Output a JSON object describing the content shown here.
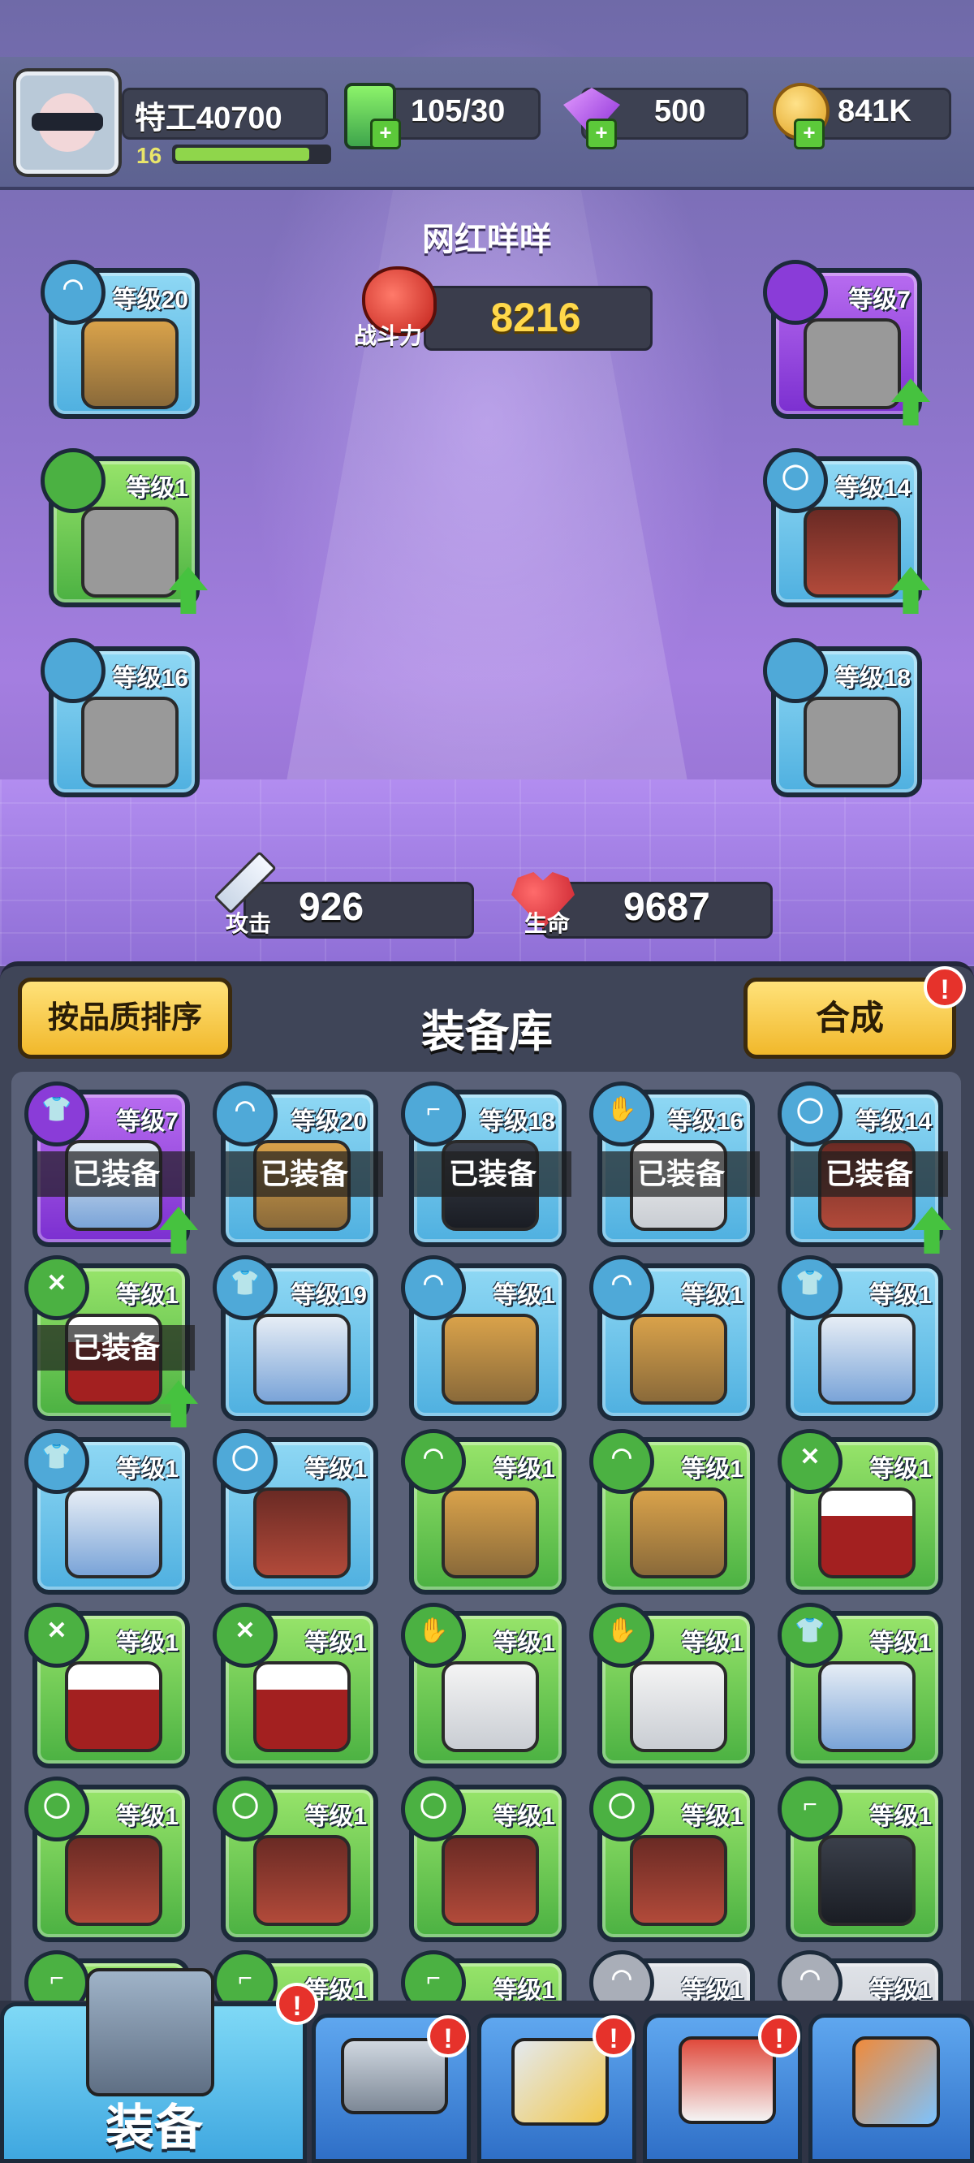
{
  "header": {
    "player_name": "特工40700",
    "player_level": "16",
    "xp_fraction": 0.88,
    "energy": "105/30",
    "gems": "500",
    "coins": "841K",
    "plus_symbol": "+"
  },
  "hero": {
    "name": "网红咩咩",
    "power_label": "战斗力",
    "power": "8216",
    "attack_label": "攻击",
    "attack": "926",
    "hp_label": "生命",
    "hp": "9687"
  },
  "equipped": [
    {
      "slot": "hat",
      "icon": "hat-icon",
      "level": "等级20",
      "quality": "blue",
      "upgrade": false
    },
    {
      "slot": "neck",
      "icon": "tie-icon",
      "level": "等级1",
      "quality": "green",
      "upgrade": true
    },
    {
      "slot": "gloves",
      "icon": "glove-icon",
      "level": "等级16",
      "quality": "blue",
      "upgrade": false
    },
    {
      "slot": "armor",
      "icon": "shirt-icon",
      "level": "等级7",
      "quality": "purple",
      "upgrade": true
    },
    {
      "slot": "belt",
      "icon": "belt-icon",
      "level": "等级14",
      "quality": "blue",
      "upgrade": true
    },
    {
      "slot": "boots",
      "icon": "boot-icon",
      "level": "等级18",
      "quality": "blue",
      "upgrade": false
    }
  ],
  "inventory": {
    "title": "装备库",
    "sort_button": "按品质排序",
    "merge_button": "合成",
    "alert_symbol": "!",
    "equipped_tag": "已装备",
    "items": [
      {
        "type": "shirt",
        "level": "等级7",
        "quality": "purple",
        "equipped": true,
        "upgrade": true
      },
      {
        "type": "hat",
        "level": "等级20",
        "quality": "blue",
        "equipped": true,
        "upgrade": false
      },
      {
        "type": "boot",
        "level": "等级18",
        "quality": "blue",
        "equipped": true,
        "upgrade": false
      },
      {
        "type": "glove",
        "level": "等级16",
        "quality": "blue",
        "equipped": true,
        "upgrade": false
      },
      {
        "type": "belt",
        "level": "等级14",
        "quality": "blue",
        "equipped": true,
        "upgrade": true
      },
      {
        "type": "tie",
        "level": "等级1",
        "quality": "green",
        "equipped": true,
        "upgrade": true
      },
      {
        "type": "shirt",
        "level": "等级19",
        "quality": "blue",
        "equipped": false,
        "upgrade": false
      },
      {
        "type": "hat",
        "level": "等级1",
        "quality": "blue",
        "equipped": false,
        "upgrade": false
      },
      {
        "type": "hat",
        "level": "等级1",
        "quality": "blue",
        "equipped": false,
        "upgrade": false
      },
      {
        "type": "shirt",
        "level": "等级1",
        "quality": "blue",
        "equipped": false,
        "upgrade": false
      },
      {
        "type": "shirt",
        "level": "等级1",
        "quality": "blue",
        "equipped": false,
        "upgrade": false
      },
      {
        "type": "belt",
        "level": "等级1",
        "quality": "blue",
        "equipped": false,
        "upgrade": false
      },
      {
        "type": "hat",
        "level": "等级1",
        "quality": "green",
        "equipped": false,
        "upgrade": false
      },
      {
        "type": "hat",
        "level": "等级1",
        "quality": "green",
        "equipped": false,
        "upgrade": false
      },
      {
        "type": "tie",
        "level": "等级1",
        "quality": "green",
        "equipped": false,
        "upgrade": false
      },
      {
        "type": "tie",
        "level": "等级1",
        "quality": "green",
        "equipped": false,
        "upgrade": false
      },
      {
        "type": "tie",
        "level": "等级1",
        "quality": "green",
        "equipped": false,
        "upgrade": false
      },
      {
        "type": "glove",
        "level": "等级1",
        "quality": "green",
        "equipped": false,
        "upgrade": false
      },
      {
        "type": "glove",
        "level": "等级1",
        "quality": "green",
        "equipped": false,
        "upgrade": false
      },
      {
        "type": "shirt",
        "level": "等级1",
        "quality": "green",
        "equipped": false,
        "upgrade": false
      },
      {
        "type": "belt",
        "level": "等级1",
        "quality": "green",
        "equipped": false,
        "upgrade": false
      },
      {
        "type": "belt",
        "level": "等级1",
        "quality": "green",
        "equipped": false,
        "upgrade": false
      },
      {
        "type": "belt",
        "level": "等级1",
        "quality": "green",
        "equipped": false,
        "upgrade": false
      },
      {
        "type": "belt",
        "level": "等级1",
        "quality": "green",
        "equipped": false,
        "upgrade": false
      },
      {
        "type": "boot",
        "level": "等级1",
        "quality": "green",
        "equipped": false,
        "upgrade": false
      },
      {
        "type": "boot",
        "level": "",
        "quality": "green",
        "equipped": false,
        "upgrade": false
      },
      {
        "type": "boot",
        "level": "等级1",
        "quality": "green",
        "equipped": false,
        "upgrade": false
      },
      {
        "type": "boot",
        "level": "等级1",
        "quality": "green",
        "equipped": false,
        "upgrade": false
      },
      {
        "type": "hat",
        "level": "等级1",
        "quality": "gray",
        "equipped": false,
        "upgrade": false
      },
      {
        "type": "hat",
        "level": "等级1",
        "quality": "gray",
        "equipped": false,
        "upgrade": false
      }
    ]
  },
  "nav": {
    "equip_label": "装备",
    "tabs": [
      "equipment-tab-icon",
      "pistol-icon",
      "crossed-swords-icon",
      "shop-icon",
      "dna-icon"
    ]
  },
  "colors": {
    "blue": "#4fb0e0",
    "green": "#4bb142",
    "purple": "#7b2fd0",
    "gray": "#b7bcc6",
    "power": "#ffd84a"
  }
}
